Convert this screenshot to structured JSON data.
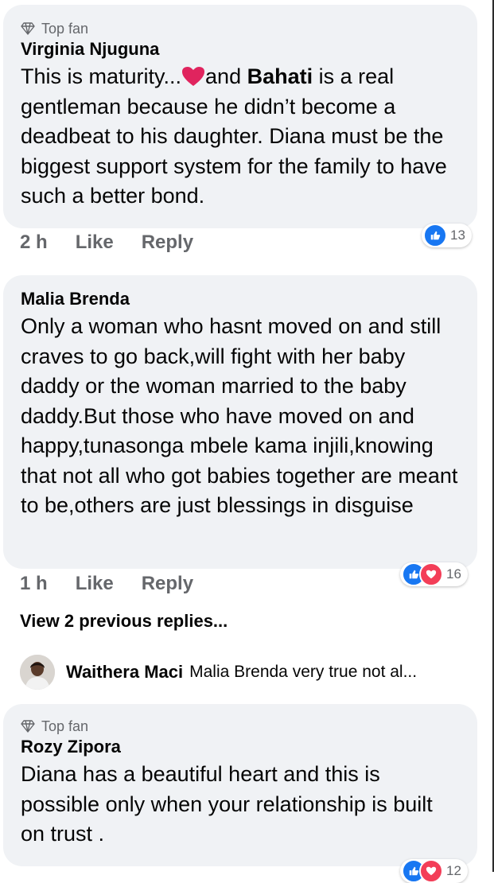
{
  "comments": [
    {
      "badge": "Top fan",
      "author": "Virginia Njuguna",
      "text_parts": {
        "a": "This is maturity...",
        "b": "and ",
        "c": "Bahati",
        "d": " is a real gentleman because he didn’t become a deadbeat to his daughter. Diana must be the biggest support system for the family to have such a better bond."
      },
      "time": "2 h",
      "like": "Like",
      "reply": "Reply",
      "reaction_count": "13",
      "reactions": [
        "like-icon"
      ]
    },
    {
      "author": "Malia Brenda",
      "text": "Only a woman who hasnt moved on and still craves to go back,will fight with her baby daddy or the woman married to the baby daddy.But those who have moved on and happy,tunasonga mbele kama injili,knowing that not all who got babies together are meant to be,others are just blessings in disguise",
      "time": "1 h",
      "like": "Like",
      "reply": "Reply",
      "reaction_count": "16",
      "reactions": [
        "like-icon",
        "love-icon"
      ]
    },
    {
      "badge": "Top fan",
      "author": "Rozy Zipora",
      "text": "Diana has a beautiful heart and this is possible only when your relationship is built on trust .",
      "reaction_count": "12",
      "reactions": [
        "like-icon",
        "love-icon"
      ]
    }
  ],
  "view_previous": "View 2 previous replies...",
  "reply_preview": {
    "author": "Waithera Maci",
    "text": "Malia Brenda very true not al..."
  },
  "colors": {
    "bubble": "#f0f2f5",
    "like_blue": "#1877f2",
    "love_red": "#f33e58",
    "meta_gray": "#65676b"
  }
}
